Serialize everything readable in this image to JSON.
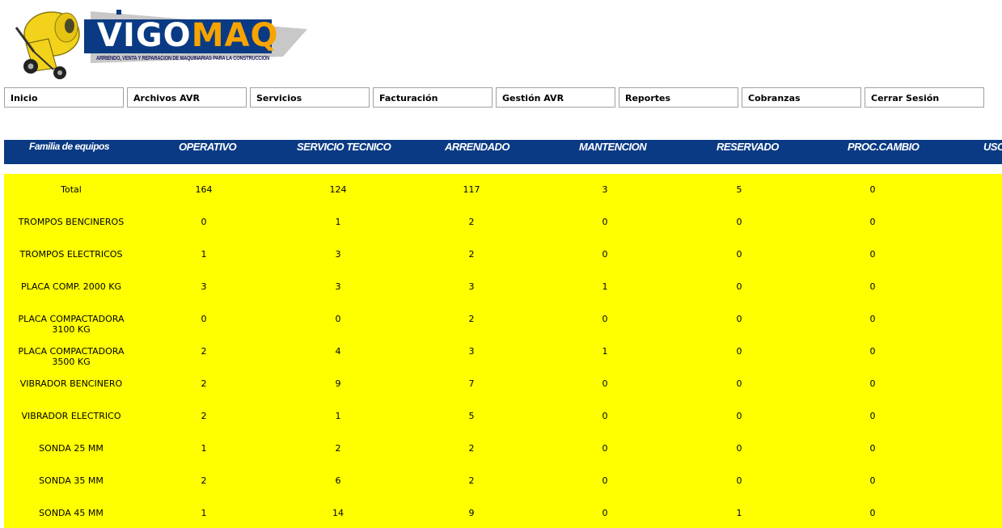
{
  "logo": {
    "title_white": "VIGO",
    "title_orange": "MAQ",
    "tagline": "ARRIENDO, VENTA Y REPARACION DE MAQUINARIAS PARA LA CONSTRUCCION",
    "colors": {
      "banner": "#0a3a84",
      "accent": "#f7a400",
      "mixer": "#f2d21a"
    }
  },
  "nav": [
    "Inicio",
    "Archivos AVR",
    "Servicios",
    "Facturación",
    "Gestión AVR",
    "Reportes",
    "Cobranzas",
    "Cerrar Sesión"
  ],
  "table": {
    "headers": [
      "Familia de equipos",
      "OPERATIVO",
      "SERVICIO TECNICO",
      "ARRENDADO",
      "MANTENCION",
      "RESERVADO",
      "PROC.CAMBIO",
      "USO"
    ],
    "rows": [
      {
        "name": "Total",
        "values": [
          "164",
          "124",
          "117",
          "3",
          "5",
          "0"
        ]
      },
      {
        "name": "TROMPOS BENCINEROS",
        "values": [
          "0",
          "1",
          "2",
          "0",
          "0",
          "0"
        ]
      },
      {
        "name": "TROMPOS ELECTRICOS",
        "values": [
          "1",
          "3",
          "2",
          "0",
          "0",
          "0"
        ]
      },
      {
        "name": "PLACA COMP. 2000 KG",
        "values": [
          "3",
          "3",
          "3",
          "1",
          "0",
          "0"
        ]
      },
      {
        "name": "PLACA COMPACTADORA 3100 KG",
        "values": [
          "0",
          "0",
          "2",
          "0",
          "0",
          "0"
        ]
      },
      {
        "name": "PLACA COMPACTADORA 3500 KG",
        "values": [
          "2",
          "4",
          "3",
          "1",
          "0",
          "0"
        ]
      },
      {
        "name": "VIBRADOR BENCINERO",
        "values": [
          "2",
          "9",
          "7",
          "0",
          "0",
          "0"
        ]
      },
      {
        "name": "VIBRADOR ELECTRICO",
        "values": [
          "2",
          "1",
          "5",
          "0",
          "0",
          "0"
        ]
      },
      {
        "name": "SONDA 25 MM",
        "values": [
          "1",
          "2",
          "2",
          "0",
          "0",
          "0"
        ]
      },
      {
        "name": "SONDA 35 MM",
        "values": [
          "2",
          "6",
          "2",
          "0",
          "0",
          "0"
        ]
      },
      {
        "name": "SONDA 45 MM",
        "values": [
          "1",
          "14",
          "9",
          "0",
          "1",
          "0"
        ]
      }
    ],
    "colors": {
      "header_bg": "#0a3a84",
      "body_bg": "#ffff00"
    }
  }
}
